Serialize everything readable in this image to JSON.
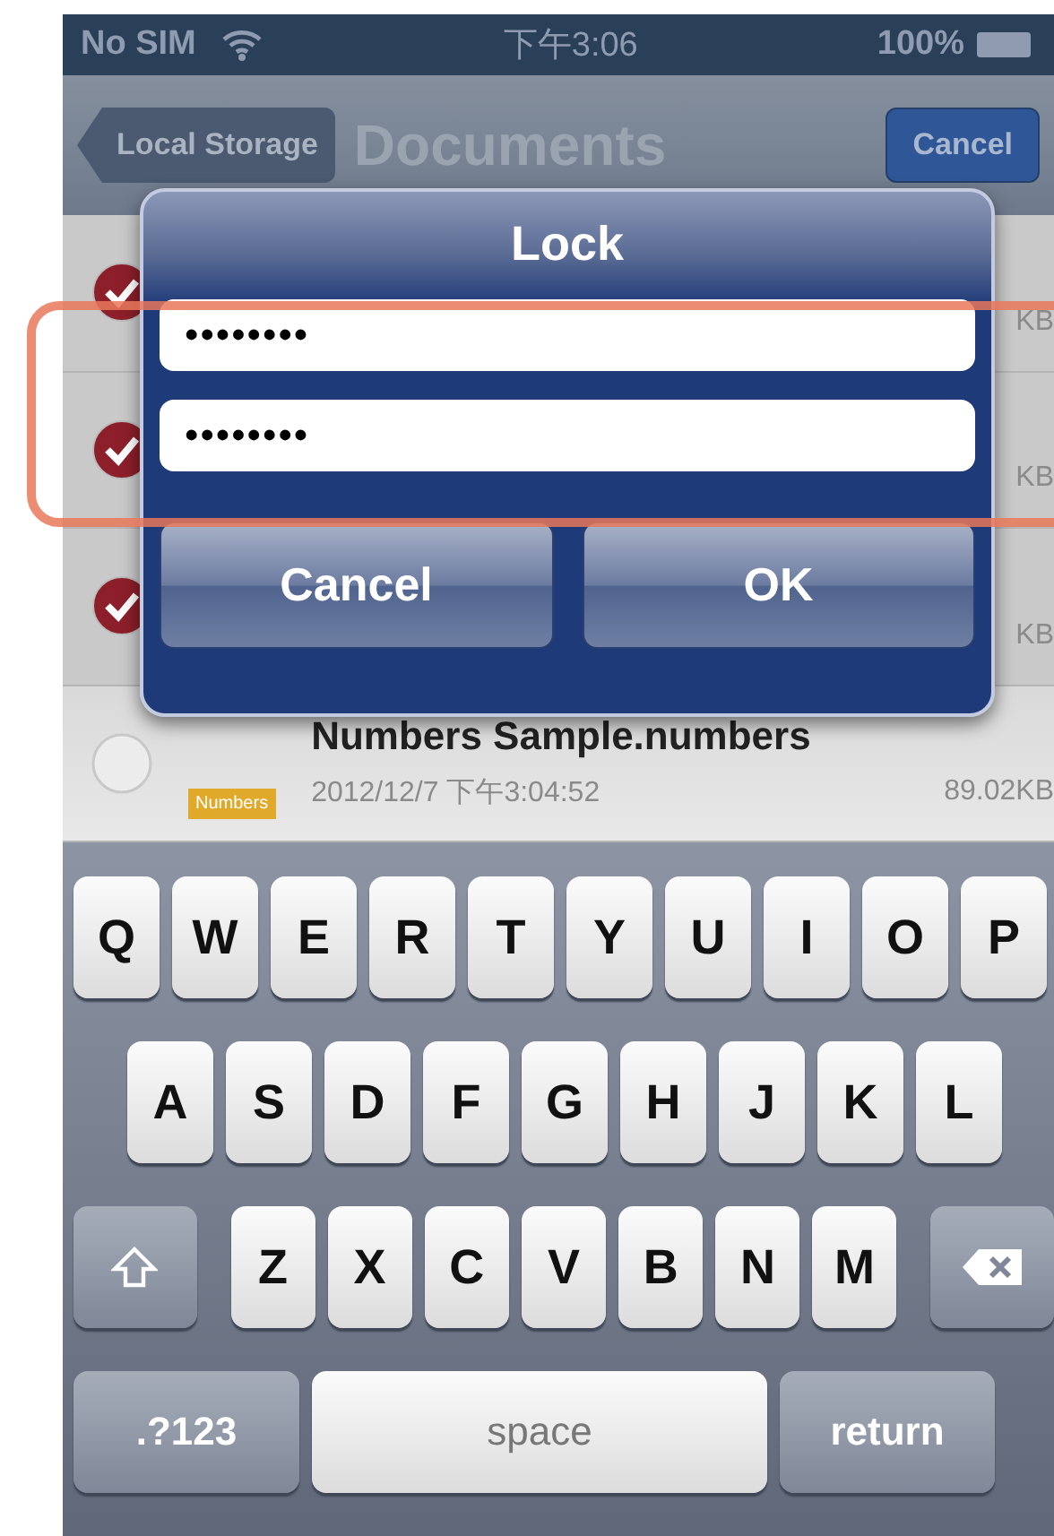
{
  "status_bar": {
    "carrier": "No SIM",
    "time": "下午3:06",
    "battery": "100%"
  },
  "nav_bar": {
    "back_button": "Local Storage",
    "title": "Documents",
    "action_button": "Cancel"
  },
  "files": [
    {
      "checked": true,
      "size": "KB"
    },
    {
      "checked": true,
      "size": "KB"
    },
    {
      "checked": true,
      "size": "KB"
    },
    {
      "checked": false,
      "name": "Numbers Sample.numbers",
      "date": "2012/12/7 下午3:04:52",
      "size": "89.02KB",
      "tag": "Numbers",
      "color": "#e0a92a"
    }
  ],
  "dialog": {
    "title": "Lock",
    "fields": [
      {
        "value": "••••••••"
      },
      {
        "value": "••••••••"
      }
    ],
    "buttons": [
      "Cancel",
      "OK"
    ]
  },
  "keyboard": {
    "rows": [
      {
        "keys": [
          {
            "kind": "letter",
            "label": "Q"
          },
          {
            "kind": "letter",
            "label": "W"
          },
          {
            "kind": "letter",
            "label": "E"
          },
          {
            "kind": "letter",
            "label": "R"
          },
          {
            "kind": "letter",
            "label": "T"
          },
          {
            "kind": "letter",
            "label": "Y"
          },
          {
            "kind": "letter",
            "label": "U"
          },
          {
            "kind": "letter",
            "label": "I"
          },
          {
            "kind": "letter",
            "label": "O"
          },
          {
            "kind": "letter",
            "label": "P"
          }
        ]
      },
      {
        "keys": [
          {
            "kind": "letter",
            "label": "A"
          },
          {
            "kind": "letter",
            "label": "S"
          },
          {
            "kind": "letter",
            "label": "D"
          },
          {
            "kind": "letter",
            "label": "F"
          },
          {
            "kind": "letter",
            "label": "G"
          },
          {
            "kind": "letter",
            "label": "H"
          },
          {
            "kind": "letter",
            "label": "J"
          },
          {
            "kind": "letter",
            "label": "K"
          },
          {
            "kind": "letter",
            "label": "L"
          }
        ]
      },
      {
        "keys": [
          {
            "kind": "shift"
          },
          {
            "kind": "letter",
            "label": "Z"
          },
          {
            "kind": "letter",
            "label": "X"
          },
          {
            "kind": "letter",
            "label": "C"
          },
          {
            "kind": "letter",
            "label": "V"
          },
          {
            "kind": "letter",
            "label": "B"
          },
          {
            "kind": "letter",
            "label": "N"
          },
          {
            "kind": "letter",
            "label": "M"
          },
          {
            "kind": "delete"
          }
        ]
      },
      {
        "keys": [
          {
            "kind": "mode",
            "label": ".?123"
          },
          {
            "kind": "space",
            "label": "space"
          },
          {
            "kind": "return",
            "label": "return"
          }
        ]
      }
    ]
  }
}
